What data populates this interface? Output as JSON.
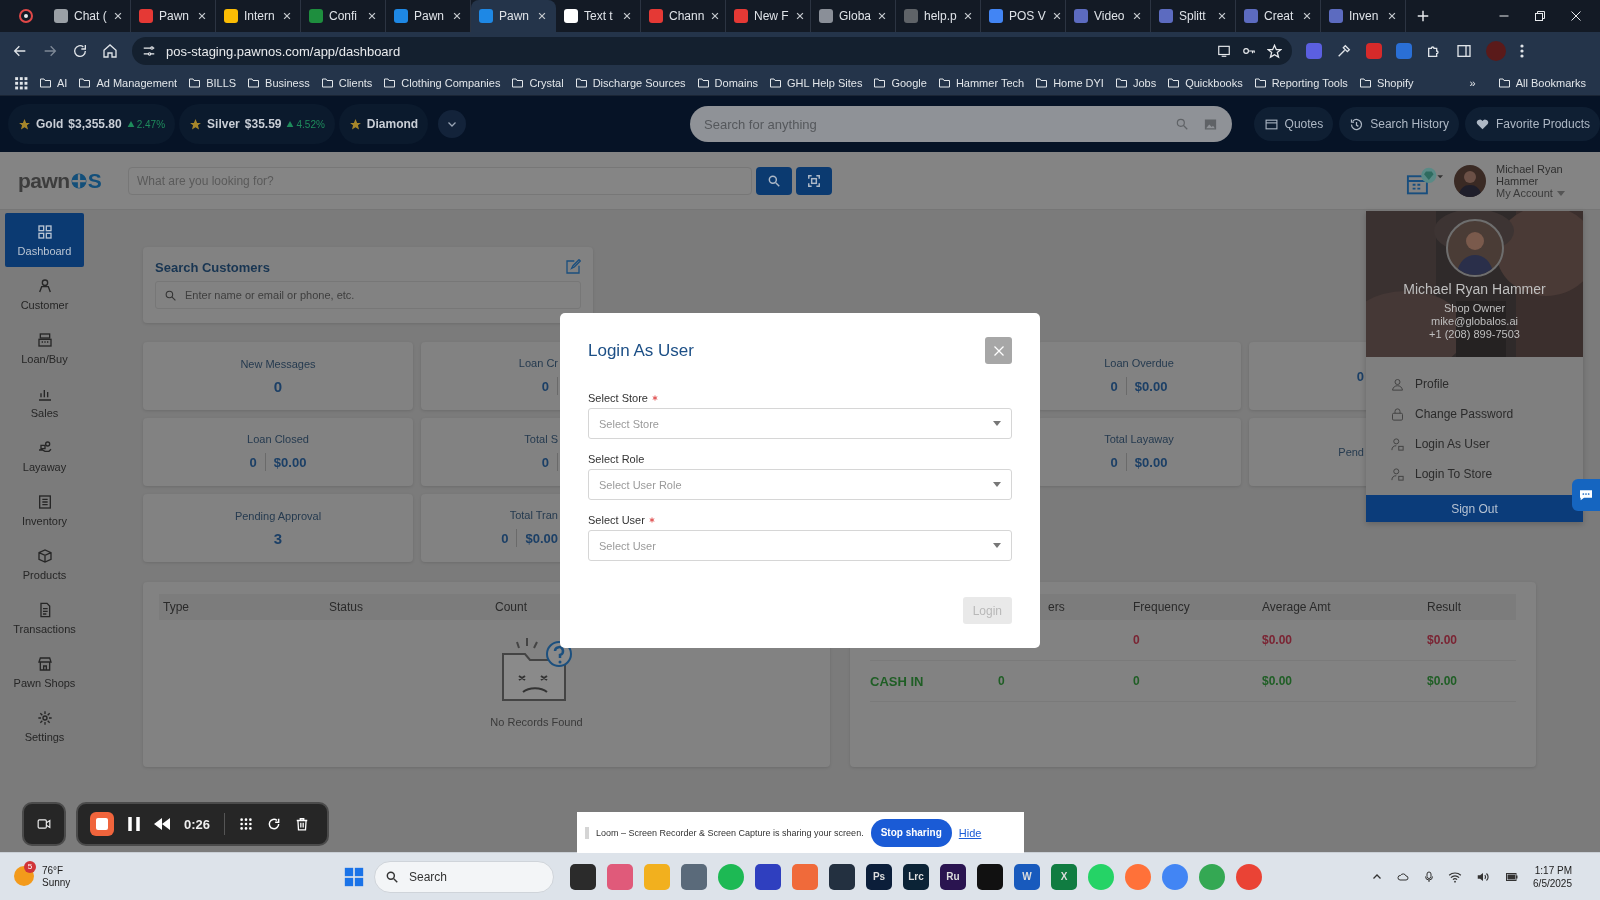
{
  "browser": {
    "tabs": [
      {
        "title": "Chat (",
        "selected": false,
        "color": "#9aa0a6"
      },
      {
        "title": "Pawn",
        "selected": false,
        "color": "#e53935"
      },
      {
        "title": "Intern",
        "selected": false,
        "color": "#fbbc04"
      },
      {
        "title": "Confi",
        "selected": false,
        "color": "#1e8e3e"
      },
      {
        "title": "Pawn",
        "selected": false,
        "color": "#1e88e5"
      },
      {
        "title": "Pawn",
        "selected": true,
        "color": "#1e88e5"
      },
      {
        "title": "Text t",
        "selected": false,
        "color": "#ffffff"
      },
      {
        "title": "Chann",
        "selected": false,
        "color": "#e53935"
      },
      {
        "title": "New F",
        "selected": false,
        "color": "#e53935"
      },
      {
        "title": "Globa",
        "selected": false,
        "color": "#8a8f98"
      },
      {
        "title": "help.p",
        "selected": false,
        "color": "#5f6368"
      },
      {
        "title": "POS V",
        "selected": false,
        "color": "#4285f4"
      },
      {
        "title": "Video",
        "selected": false,
        "color": "#5c6bc0"
      },
      {
        "title": "Splitt",
        "selected": false,
        "color": "#5c6bc0"
      },
      {
        "title": "Creat",
        "selected": false,
        "color": "#5c6bc0"
      },
      {
        "title": "Inven",
        "selected": false,
        "color": "#5c6bc0"
      }
    ],
    "address": "pos-staging.pawnos.com/app/dashboard",
    "bookmarks": [
      "AI",
      "Ad Management",
      "BILLS",
      "Business",
      "Clients",
      "Clothing Companies",
      "Crystal",
      "Discharge Sources",
      "Domains",
      "GHL Help Sites",
      "Google",
      "Hammer Tech",
      "Home DYI",
      "Jobs",
      "Quickbooks",
      "Reporting Tools",
      "Shopify"
    ],
    "more": "»",
    "all_bookmarks": "All Bookmarks"
  },
  "ticker": [
    {
      "name": "Gold",
      "price": "$3,355.80",
      "change": "2.47%"
    },
    {
      "name": "Silver",
      "price": "$35.59",
      "change": "4.52%"
    },
    {
      "name": "Diamond"
    }
  ],
  "top_search": {
    "placeholder": "Search for anything"
  },
  "top_buttons": [
    {
      "label": "Quotes",
      "kind": "quotes"
    },
    {
      "label": "Search History",
      "kind": "history"
    },
    {
      "label": "Favorite Products",
      "kind": "favorite"
    }
  ],
  "logo": [
    "pawn",
    "S"
  ],
  "app_search": {
    "placeholder": "What are you looking for?"
  },
  "account": {
    "name": "Michael Ryan Hammer",
    "link": "My Account"
  },
  "sidebar": [
    {
      "label": "Dashboard",
      "kind": "dashboard",
      "selected": true
    },
    {
      "label": "Customer",
      "kind": "customer",
      "selected": false
    },
    {
      "label": "Loan/Buy",
      "kind": "loan",
      "selected": false
    },
    {
      "label": "Sales",
      "kind": "sales",
      "selected": false
    },
    {
      "label": "Layaway",
      "kind": "layaway",
      "selected": false
    },
    {
      "label": "Inventory",
      "kind": "inventory",
      "selected": false
    },
    {
      "label": "Products",
      "kind": "products",
      "selected": false
    },
    {
      "label": "Transactions",
      "kind": "transactions",
      "selected": false
    },
    {
      "label": "Pawn Shops",
      "kind": "shops",
      "selected": false
    },
    {
      "label": "Settings",
      "kind": "settings",
      "selected": false
    }
  ],
  "search_customers": {
    "title": "Search Customers",
    "placeholder": "Enter name or email or phone, etc."
  },
  "stats": {
    "left": [
      [
        {
          "kind": "single",
          "label": "New Messages",
          "value": "0"
        },
        {
          "kind": "pair",
          "label": "Loan Cr",
          "count": "0"
        }
      ],
      [
        {
          "kind": "pair",
          "label": "Loan Closed",
          "count": "0",
          "amount": "$0.00"
        },
        {
          "kind": "pair",
          "label": "Total S",
          "count": "0"
        }
      ],
      [
        {
          "kind": "single",
          "label": "Pending Approval",
          "value": "3"
        },
        {
          "kind": "pair",
          "label": "Total Tran",
          "count": "0",
          "amount": "$0.00"
        }
      ]
    ],
    "right": [
      [
        {
          "kind": "pair",
          "label": "Loan Overdue",
          "count": "0",
          "amount": "$0.00"
        },
        {
          "kind": "pair",
          "count": "0"
        }
      ],
      [
        {
          "kind": "pair",
          "label": "Total Layaway",
          "count": "0",
          "amount": "$0.00"
        },
        {
          "kind": "pair",
          "label": "Pend"
        }
      ]
    ]
  },
  "activity_table": {
    "columns": [
      "Type",
      "Status",
      "Count"
    ],
    "empty": "No Records Found"
  },
  "cash_table": {
    "columns": [
      "ers",
      "Frequency",
      "Average Amt",
      "Result"
    ],
    "rows": [
      {
        "color": "#7a2433",
        "frequency": "0",
        "average": "$0.00",
        "result": "$0.00"
      },
      {
        "color": "#1f5e25",
        "type": "CASH IN",
        "column_2": "0",
        "frequency": "0",
        "average": "$0.00",
        "result": "$0.00"
      }
    ]
  },
  "account_menu": {
    "name": "Michael Ryan Hammer",
    "role": "Shop Owner",
    "email": "mike@globalos.ai",
    "phone": "+1 (208) 899-7503",
    "items": [
      {
        "label": "Profile",
        "kind": "profile"
      },
      {
        "label": "Change Password",
        "kind": "password"
      },
      {
        "label": "Login As User",
        "kind": "user"
      },
      {
        "label": "Login To Store",
        "kind": "user"
      }
    ],
    "sign_out": "Sign Out"
  },
  "modal": {
    "title": "Login As User",
    "fields": [
      {
        "label": "Select Store",
        "required": true,
        "placeholder": "Select Store"
      },
      {
        "label": "Select Role",
        "required": false,
        "placeholder": "Select User Role"
      },
      {
        "label": "Select User",
        "required": true,
        "placeholder": "Select User"
      }
    ],
    "button": {
      "label": "Login",
      "disabled": true
    }
  },
  "loom": {
    "timer": "0:26",
    "banner": "Loom – Screen Recorder & Screen Capture is sharing your screen.",
    "stop": "Stop sharing",
    "hide": "Hide"
  },
  "taskbar": {
    "weather": {
      "badge": "5",
      "temp": "76°F",
      "text": "Sunny"
    },
    "search": "Search",
    "apps": [
      {
        "kind": "tile",
        "color": "#2b2b2b"
      },
      {
        "kind": "tile",
        "color": "#e05a7a"
      },
      {
        "kind": "tile",
        "color": "#f2b01e"
      },
      {
        "kind": "tile",
        "color": "#5a6a7a"
      },
      {
        "kind": "round",
        "color": "#1db954"
      },
      {
        "kind": "tile",
        "color": "#2f3fbf"
      },
      {
        "kind": "tile",
        "color": "#f06a3a"
      },
      {
        "kind": "tile",
        "color": "#233040"
      },
      {
        "kind": "tile",
        "color": "#0b1e3a",
        "label": "Ps"
      },
      {
        "kind": "tile",
        "color": "#0b2336",
        "label": "Lrc"
      },
      {
        "kind": "tile",
        "color": "#2a1450",
        "label": "Ru"
      },
      {
        "kind": "tile",
        "color": "#111111"
      },
      {
        "kind": "tile",
        "color": "#185abd",
        "label": "W"
      },
      {
        "kind": "tile",
        "color": "#107c41",
        "label": "X"
      },
      {
        "kind": "round",
        "color": "#25d366"
      },
      {
        "kind": "round",
        "color": "#ff7139"
      },
      {
        "kind": "round",
        "color": "#4285f4"
      },
      {
        "kind": "round",
        "color": "#34a853"
      },
      {
        "kind": "round",
        "color": "#ea4335"
      }
    ],
    "time": "1:17 PM",
    "date": "6/5/2025"
  }
}
